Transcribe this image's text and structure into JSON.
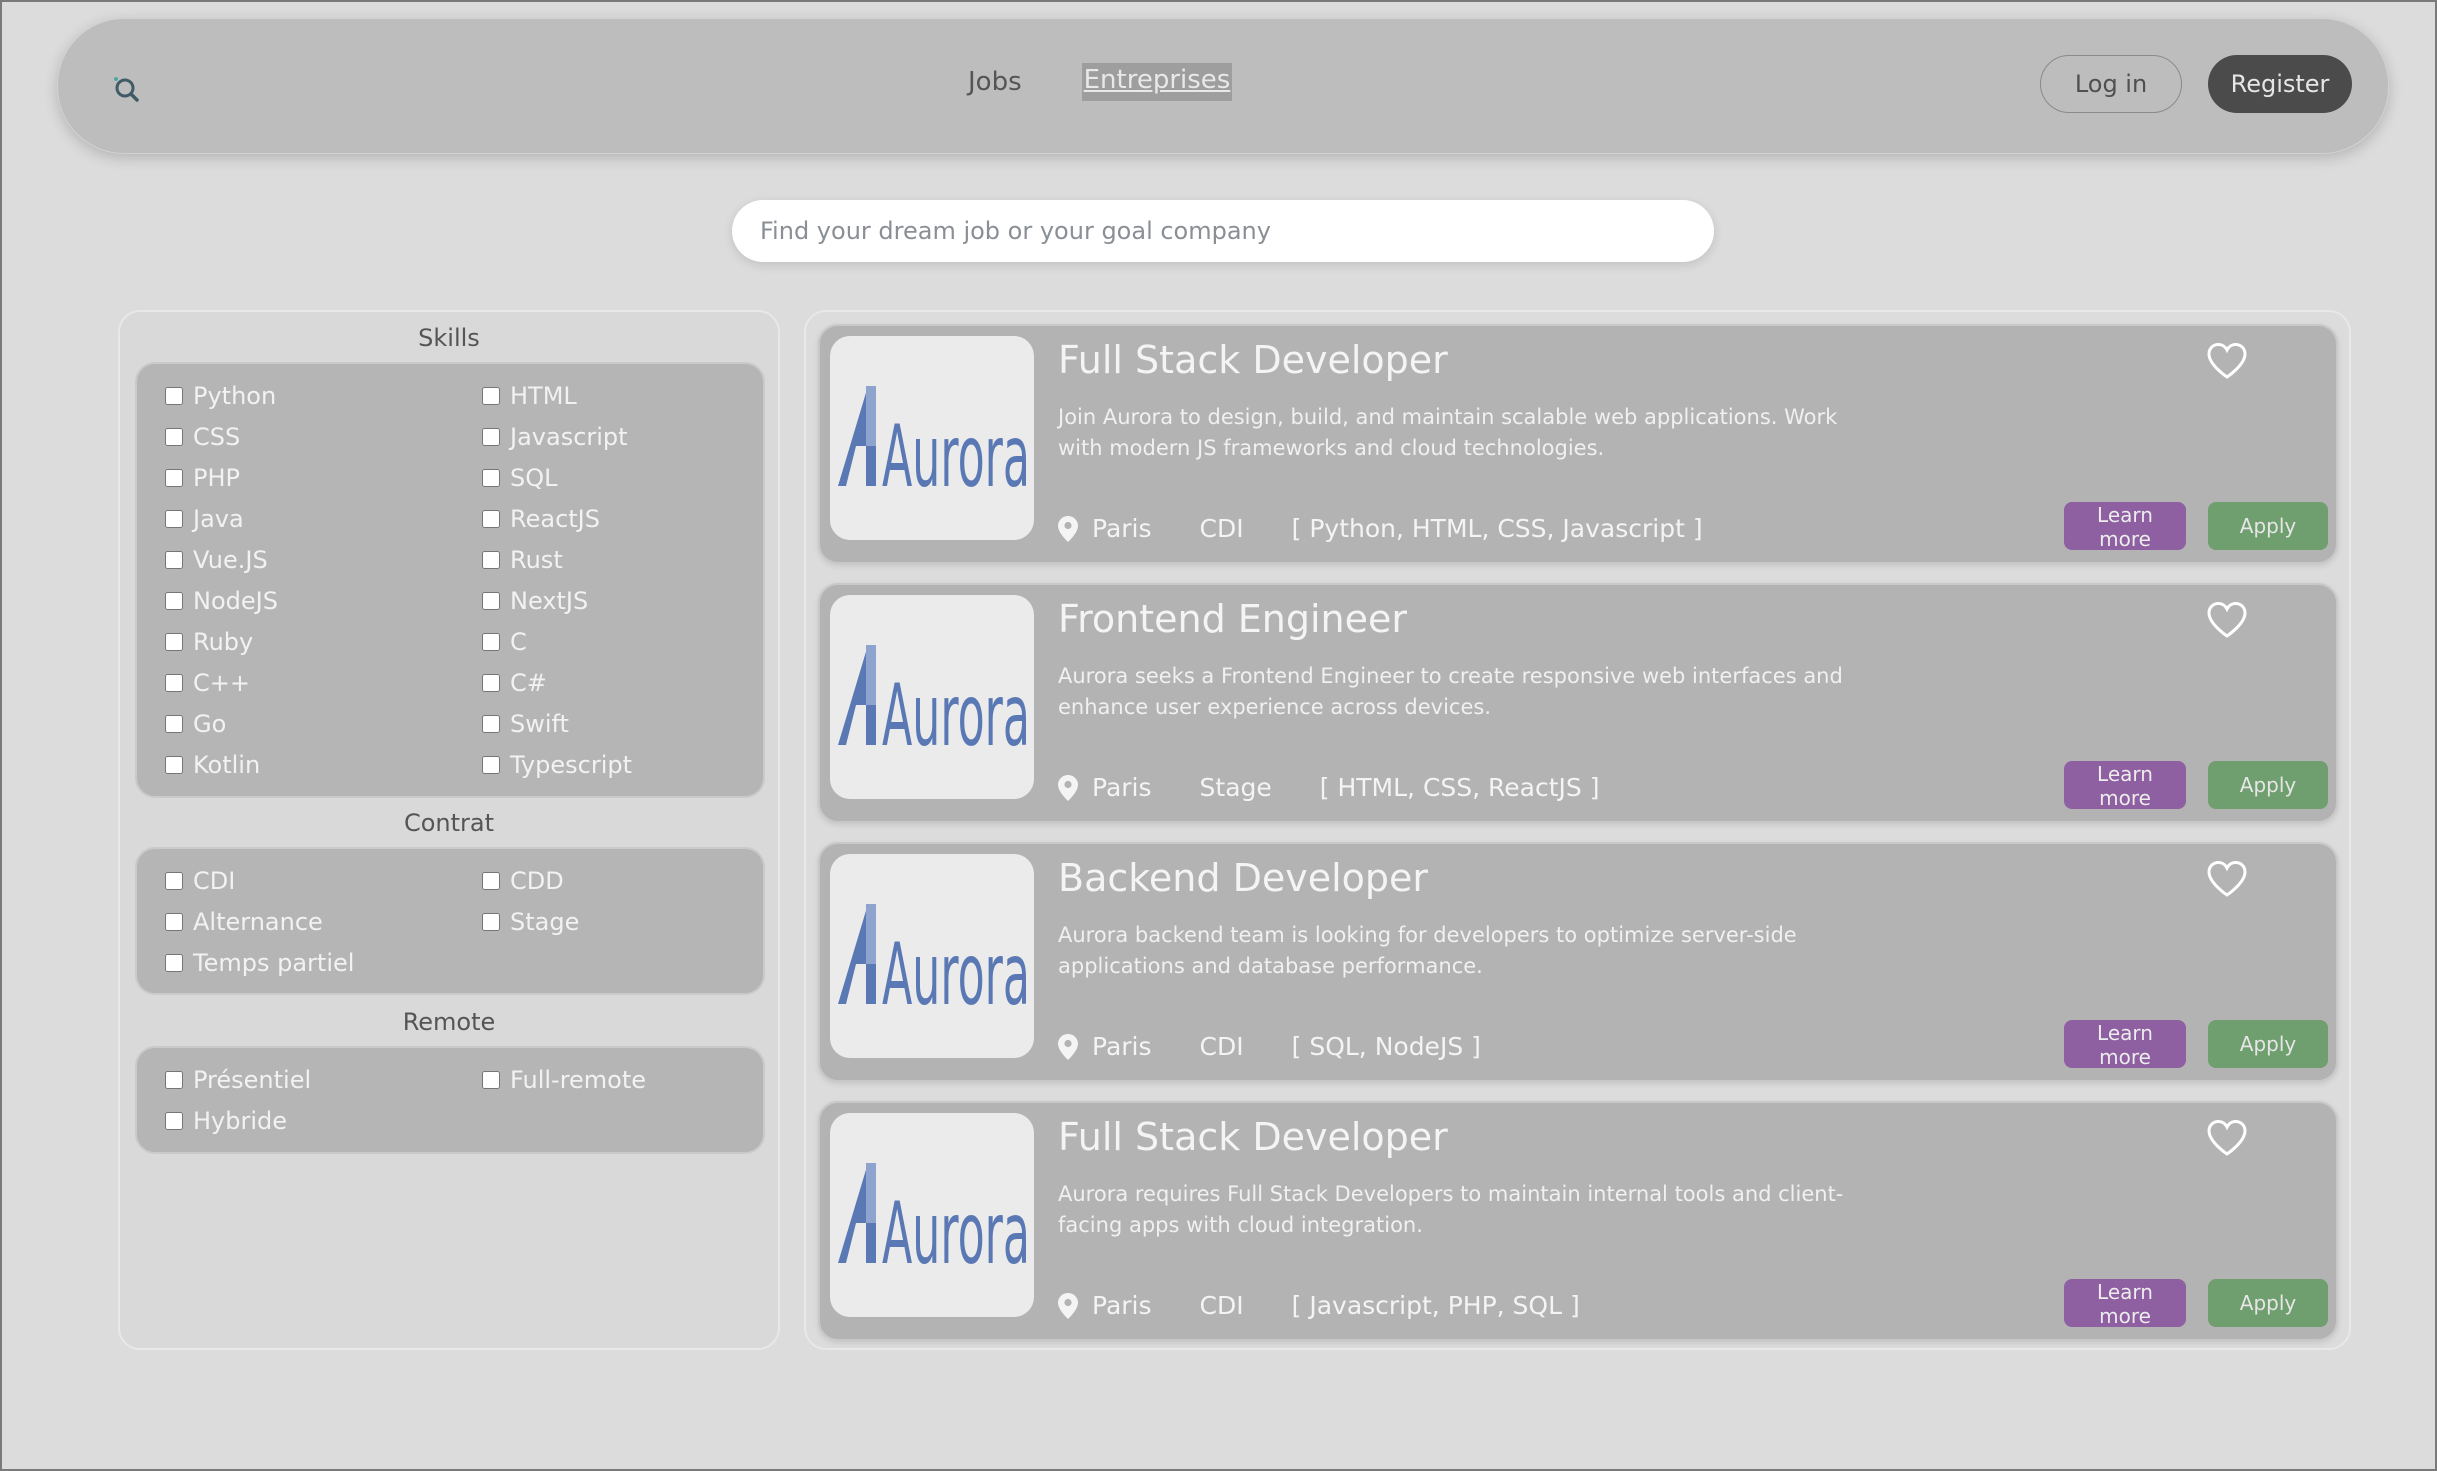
{
  "nav": {
    "links": [
      "Jobs",
      "Entreprises"
    ],
    "login_label": "Log in",
    "register_label": "Register"
  },
  "search": {
    "placeholder": "Find your dream job or your goal company",
    "value": ""
  },
  "filters": {
    "skills": {
      "title": "Skills",
      "options": [
        "Python",
        "HTML",
        "CSS",
        "Javascript",
        "PHP",
        "SQL",
        "Java",
        "ReactJS",
        "Vue.JS",
        "Rust",
        "NodeJS",
        "NextJS",
        "Ruby",
        "C",
        "C++",
        "C#",
        "Go",
        "Swift",
        "Kotlin",
        "Typescript"
      ]
    },
    "contrat": {
      "title": "Contrat",
      "options": [
        "CDI",
        "CDD",
        "Alternance",
        "Stage",
        "Temps partiel"
      ]
    },
    "remote": {
      "title": "Remote",
      "options": [
        "Présentiel",
        "Full-remote",
        "Hybride"
      ]
    }
  },
  "jobs": [
    {
      "company_logo": "Aurora",
      "title": "Full Stack Developer",
      "description": "Join Aurora to design, build, and maintain scalable web applications. Work with modern JS frameworks and cloud technologies.",
      "location": "Paris",
      "contract": "CDI",
      "skills": "[ Python, HTML, CSS, Javascript ]",
      "learn_more_label": "Learn more",
      "apply_label": "Apply"
    },
    {
      "company_logo": "Aurora",
      "title": "Frontend Engineer",
      "description": "Aurora seeks a Frontend Engineer to create responsive web interfaces and enhance user experience across devices.",
      "location": "Paris",
      "contract": "Stage",
      "skills": "[ HTML, CSS, ReactJS ]",
      "learn_more_label": "Learn more",
      "apply_label": "Apply"
    },
    {
      "company_logo": "Aurora",
      "title": "Backend Developer",
      "description": "Aurora backend team is looking for developers to optimize server-side applications and database performance.",
      "location": "Paris",
      "contract": "CDI",
      "skills": "[ SQL, NodeJS ]",
      "learn_more_label": "Learn more",
      "apply_label": "Apply"
    },
    {
      "company_logo": "Aurora",
      "title": "Full Stack Developer",
      "description": "Aurora requires Full Stack Developers to maintain internal tools and client-facing apps with cloud integration.",
      "location": "Paris",
      "contract": "CDI",
      "skills": "[ Javascript, PHP, SQL ]",
      "learn_more_label": "Learn more",
      "apply_label": "Apply"
    }
  ],
  "colors": {
    "learn_more": "#8e5fa1",
    "apply": "#6f9e6f",
    "register": "#4b4b4b",
    "aurora_logo": "#5a78b4"
  },
  "icons": {
    "logo": "magnifier-logo-icon",
    "heart": "heart-outline-icon",
    "location": "map-pin-icon"
  }
}
